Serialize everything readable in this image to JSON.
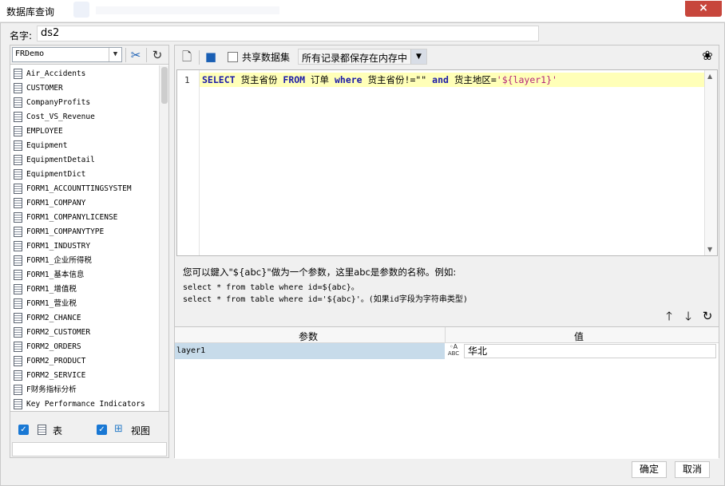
{
  "window": {
    "title": "数据库查询",
    "close_glyph": "×"
  },
  "name_field": {
    "label": "名字:",
    "value": "ds2"
  },
  "left": {
    "database": "FRDemo",
    "tables": [
      "Air_Accidents",
      "CUSTOMER",
      "CompanyProfits",
      "Cost_VS_Revenue",
      "EMPLOYEE",
      "Equipment",
      "EquipmentDetail",
      "EquipmentDict",
      "FORM1_ACCOUNTTINGSYSTEM",
      "FORM1_COMPANY",
      "FORM1_COMPANYLICENSE",
      "FORM1_COMPANYTYPE",
      "FORM1_INDUSTRY",
      "FORM1_企业所得税",
      "FORM1_基本信息",
      "FORM1_增值税",
      "FORM1_营业税",
      "FORM2_CHANCE",
      "FORM2_CUSTOMER",
      "FORM2_ORDERS",
      "FORM2_PRODUCT",
      "FORM2_SERVICE",
      "F财务指标分析",
      "Key Performance Indicators"
    ],
    "show_tables_label": "表",
    "show_views_label": "视图"
  },
  "toolbar": {
    "share_label": "共享数据集",
    "storage_mode": "所有记录都保存在内存中"
  },
  "editor": {
    "line_number": "1",
    "sql": {
      "kw_select": "SELECT",
      "t1": " 货主省份 ",
      "kw_from": "FROM",
      "t2": " 订单 ",
      "kw_where": "where",
      "t3": " 货主省份!=\"\" ",
      "kw_and": "and",
      "t4": " 货主地区=",
      "param": "'${layer1}'"
    }
  },
  "help": {
    "line1": "您可以鍵入\"${abc}\"做为一个参数，这里abc是参数的名称。例如:",
    "line2": "select * from table where id=${abc}。",
    "line3": "select * from table where id='${abc}'。(如果id字段为字符串类型)"
  },
  "params": {
    "col_param": "参数",
    "col_value": "值",
    "rows": [
      {
        "name": "layer1",
        "type": "ABC",
        "value": "华北"
      }
    ]
  },
  "buttons": {
    "ok": "确定",
    "cancel": "取消"
  }
}
